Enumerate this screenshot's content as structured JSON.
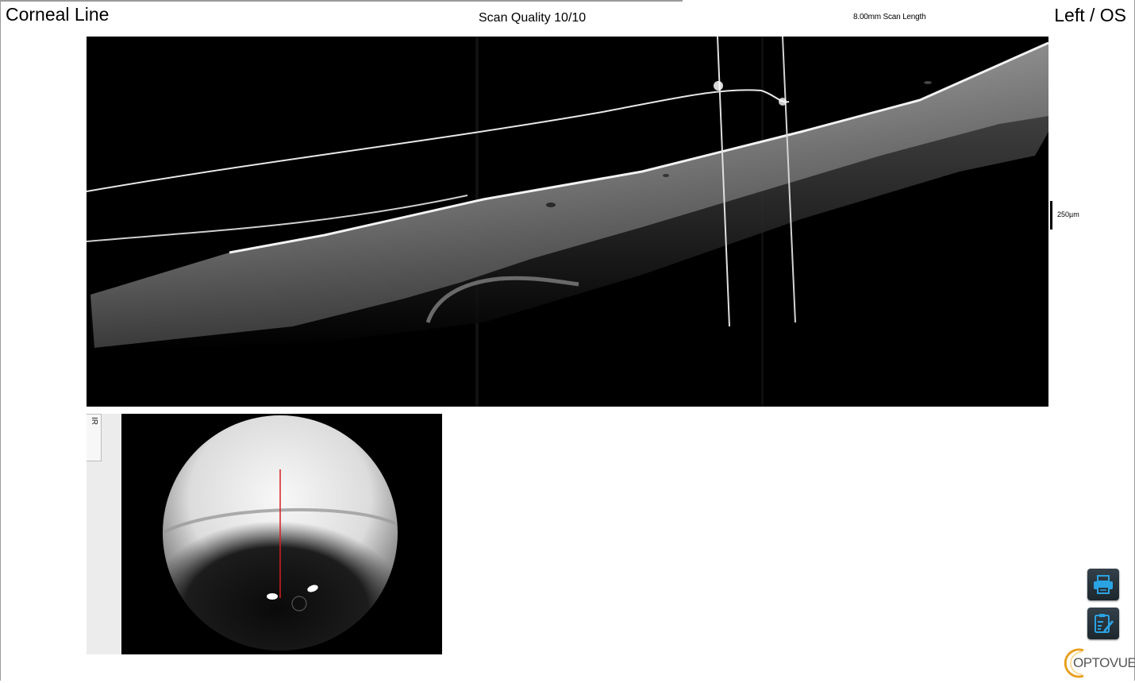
{
  "header": {
    "title": "Corneal Line",
    "scan_quality": "Scan Quality 10/10",
    "scan_length": "8.00mm Scan Length",
    "eye": "Left / OS"
  },
  "bscan": {
    "scale_label": "250µm"
  },
  "ir_panel": {
    "tab_label": "IR"
  },
  "toolbar": {
    "print_icon": "printer-icon",
    "report_icon": "clipboard-edit-icon"
  },
  "brand": {
    "logo_text": "OPTOVUE"
  },
  "colors": {
    "button_bg": "#26323a",
    "button_icon": "#2aa3e3",
    "scan_line": "#d81e1e",
    "logo_ring": "#e8a020"
  }
}
